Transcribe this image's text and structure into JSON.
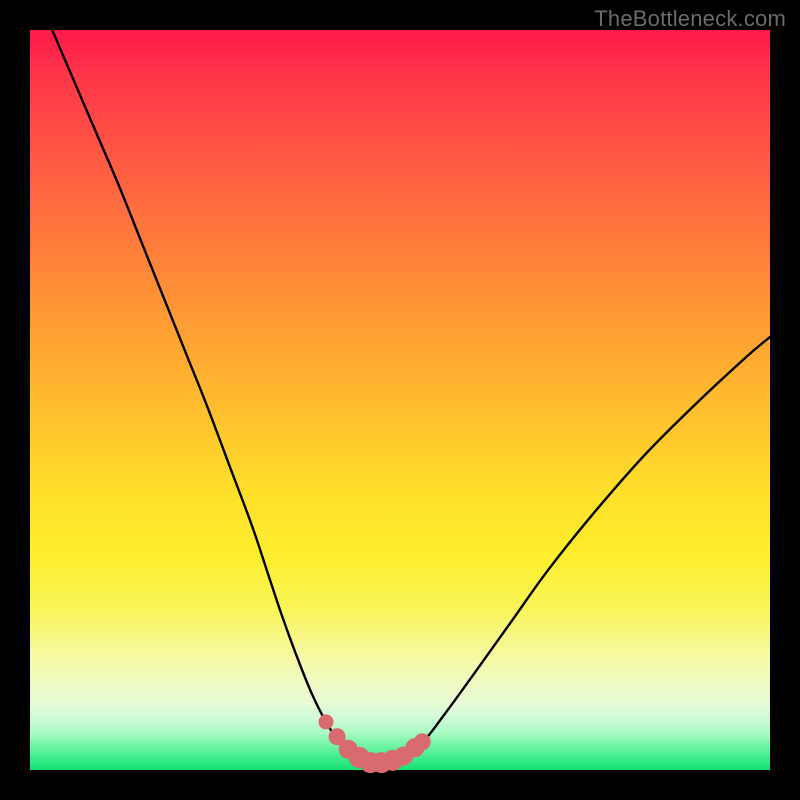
{
  "watermark": {
    "text": "TheBottleneck.com"
  },
  "colors": {
    "page_bg": "#000000",
    "curve_stroke": "#000000",
    "marker_fill": "#d96a6f",
    "marker_stroke": "#d96a6f"
  },
  "chart_data": {
    "type": "line",
    "title": "",
    "xlabel": "",
    "ylabel": "",
    "xlim": [
      0,
      100
    ],
    "ylim": [
      0,
      100
    ],
    "grid": false,
    "legend": false,
    "series": [
      {
        "name": "bottleneck-curve",
        "x": [
          3.0,
          6.0,
          9.0,
          12.0,
          15.0,
          18.0,
          21.0,
          24.0,
          27.0,
          30.0,
          32.0,
          34.0,
          36.0,
          38.0,
          40.0,
          42.0,
          44.0,
          46.0,
          48.0,
          50.0,
          53.0,
          56.0,
          60.0,
          65.0,
          70.0,
          76.0,
          83.0,
          90.0,
          97.0,
          100.0
        ],
        "y": [
          100.0,
          93.0,
          86.0,
          79.0,
          71.5,
          64.0,
          56.5,
          49.0,
          41.0,
          33.0,
          27.0,
          21.0,
          15.5,
          10.5,
          6.5,
          3.5,
          1.8,
          1.0,
          1.0,
          1.6,
          3.7,
          7.5,
          13.0,
          20.0,
          27.0,
          34.5,
          42.5,
          49.5,
          56.0,
          58.5
        ]
      }
    ],
    "markers": {
      "name": "valley-highlight",
      "x": [
        40.0,
        41.5,
        43.0,
        44.5,
        46.0,
        47.5,
        49.0,
        50.5,
        52.0,
        53.0
      ],
      "y": [
        6.5,
        4.5,
        2.8,
        1.7,
        1.0,
        1.0,
        1.3,
        1.9,
        3.0,
        3.8
      ],
      "size": [
        7,
        8,
        9,
        10,
        10,
        10,
        10,
        9,
        9,
        8
      ]
    }
  }
}
